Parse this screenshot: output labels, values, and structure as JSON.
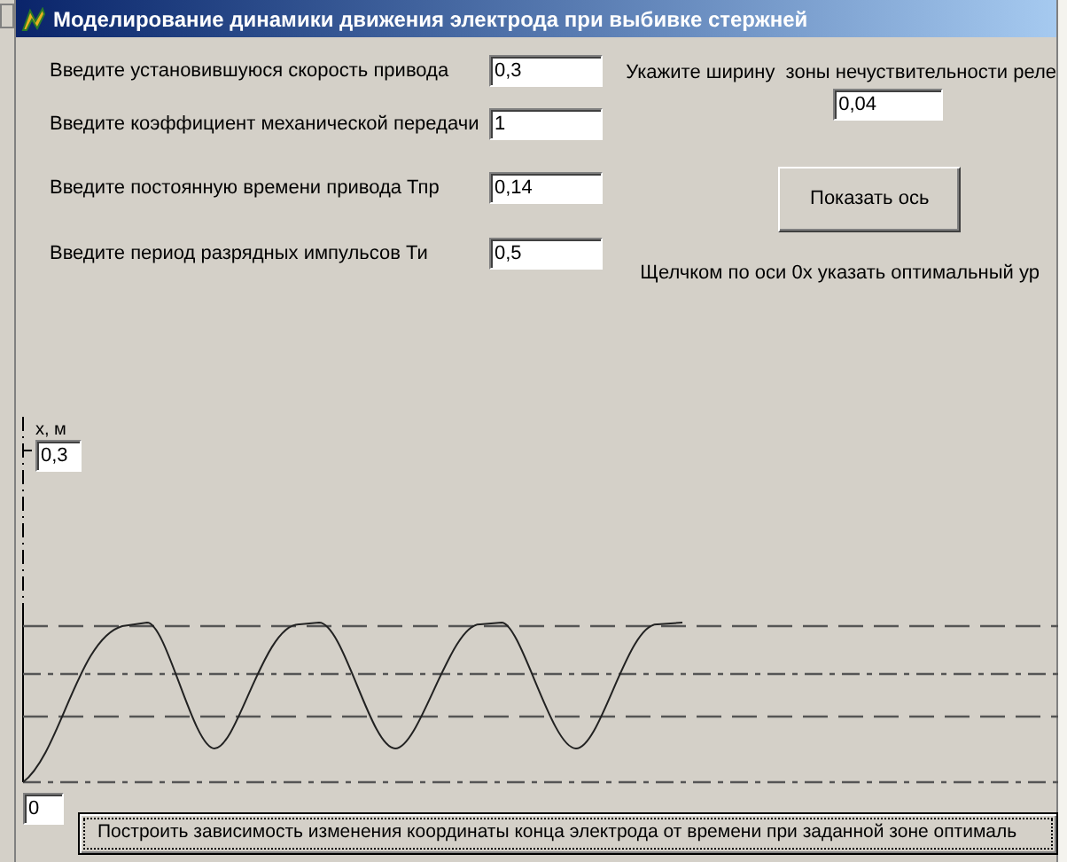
{
  "window": {
    "title": "Моделирование динамики движения электрода при выбивке стержней"
  },
  "inputs": [
    {
      "label": "Введите установившуюся скорость привода",
      "value": "0,3"
    },
    {
      "label": "Введите коэффициент механической передачи",
      "value": "1"
    },
    {
      "label": "Введите постоянную времени привода Тпр",
      "value": "0,14"
    },
    {
      "label": "Введите период разрядных импульсов Ти",
      "value": "0,5"
    }
  ],
  "relay_zone": {
    "label": "Укажите ширину  зоны нечуствительности реле",
    "value": "0,04"
  },
  "show_axis_button": "Показать ось",
  "hint": "Щелчком по оси 0x указать оптимальный ур",
  "plot": {
    "y_axis_label": "x, м",
    "y_max": "0,3",
    "y_min": "0"
  },
  "build_button": "Построить зависимость изменения координаты конца электрода от времени при заданной зоне оптималь"
}
